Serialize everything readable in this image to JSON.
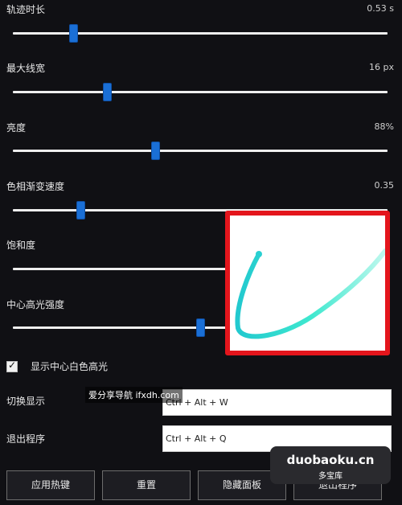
{
  "sliders": [
    {
      "label": "轨迹时长",
      "value": "0.53 s",
      "level": 0.16
    },
    {
      "label": "最大线宽",
      "value": "16 px",
      "level": 0.25
    },
    {
      "label": "亮度",
      "value": "88%",
      "level": 0.38
    },
    {
      "label": "色相渐变速度",
      "value": "0.35",
      "level": 0.18
    },
    {
      "label": "饱和度",
      "value": "",
      "level": null
    },
    {
      "label": "中心高光强度",
      "value": "",
      "level": 0.5
    }
  ],
  "checkbox": {
    "label": "显示中心白色高光",
    "checked": true
  },
  "hotkeys": [
    {
      "label": "切换显示",
      "value": "Ctrl + Alt + W"
    },
    {
      "label": "退出程序",
      "value": "Ctrl + Alt + Q"
    }
  ],
  "buttons": [
    "应用热键",
    "重置",
    "隐藏面板",
    "退出程序"
  ],
  "watermark": {
    "site": "爱分享导航 ifxdh.com",
    "brand": "duobaoku.cn",
    "brand_sub": "多宝库"
  },
  "colors": {
    "accent": "#1a6fd6",
    "highlight_border": "#e4151c",
    "stroke": "#38e0d0"
  }
}
